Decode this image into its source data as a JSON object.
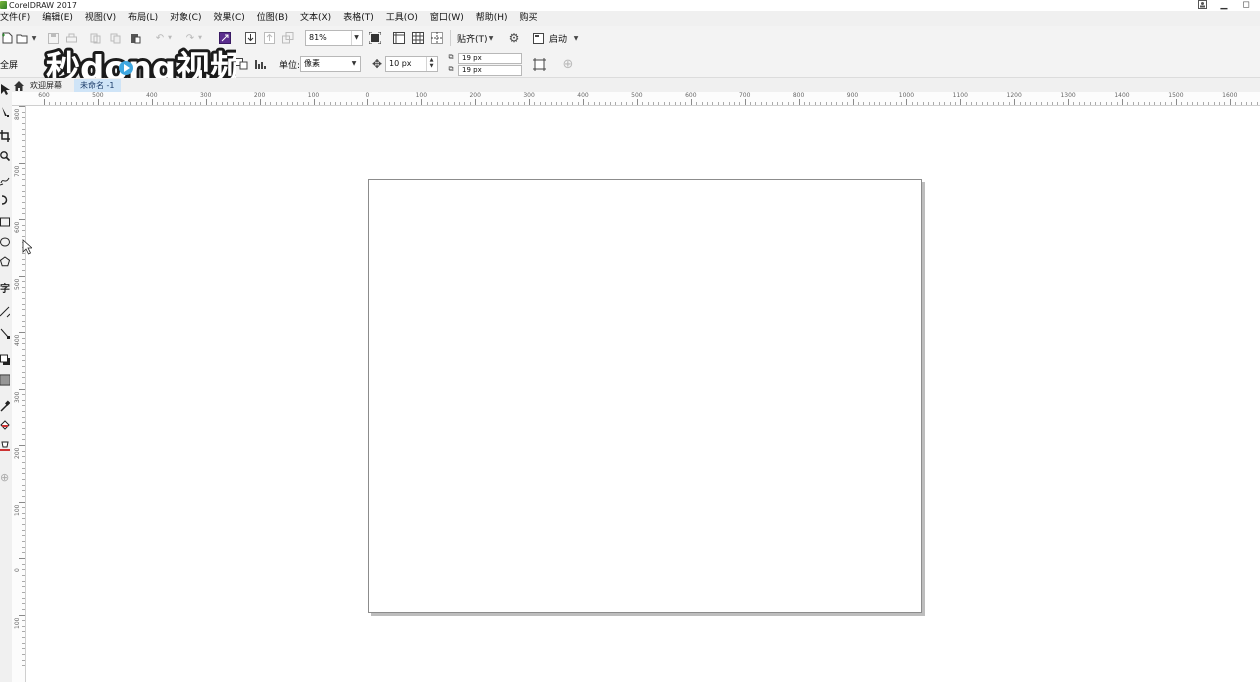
{
  "window": {
    "title": "CorelDRAW 2017",
    "controls": [
      "▁",
      "◻"
    ]
  },
  "menu": [
    "文件(F)",
    "编辑(E)",
    "视图(V)",
    "布局(L)",
    "对象(C)",
    "效果(C)",
    "位图(B)",
    "文本(X)",
    "表格(T)",
    "工具(O)",
    "窗口(W)",
    "帮助(H)",
    "购买"
  ],
  "toolbar": {
    "zoom_value": "81%",
    "snap_label": "贴齐(T)",
    "launch_label": "启动"
  },
  "property_bar": {
    "fullscreen_label": "全屏",
    "unit_label": "单位:",
    "unit_value": "像素",
    "nudge_value": "10 px",
    "duplicate_x": "19 px",
    "duplicate_y": "19 px"
  },
  "tabs": {
    "welcome": "欢迎屏幕",
    "document": "未命名 -1"
  },
  "watermark": {
    "text": "秒dong视频"
  },
  "ruler": {
    "horizontal_labels": [
      "600",
      "500",
      "400",
      "300",
      "200",
      "100",
      "0",
      "100",
      "200",
      "300",
      "400",
      "500",
      "600",
      "700",
      "800",
      "900",
      "1000",
      "1100",
      "1200",
      "1300",
      "1400",
      "1500",
      "1600"
    ],
    "vertical_labels": [
      "800",
      "700",
      "600",
      "500",
      "400",
      "300",
      "200",
      "100",
      "0",
      "100"
    ]
  },
  "colors": {
    "active_tab": "#cfe4f7",
    "page_shadow": "#bdbdbd",
    "toolbar_bg": "#f3f3f3"
  }
}
